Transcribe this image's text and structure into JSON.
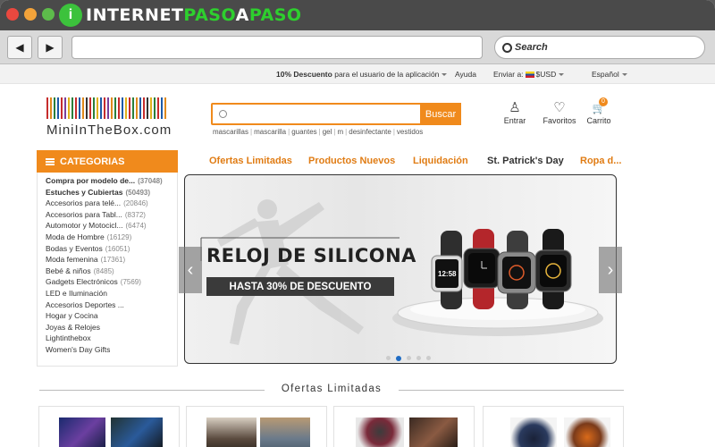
{
  "browser": {
    "brand": {
      "part1": "INTERNET",
      "part2": "PASO",
      "part3": "A",
      "part4": "PASO",
      "logo_glyph": "i"
    },
    "back_icon": "◀",
    "forward_icon": "▶",
    "url": "",
    "search_label": "Search",
    "traffic_lights": [
      "#e9483f",
      "#f3a33a",
      "#5dbb4b"
    ]
  },
  "topbar": {
    "promo_bold": "10% Descuento",
    "promo_rest": "para el usuario de la aplicación",
    "help": "Ayuda",
    "ship_to": "Enviar a:",
    "currency": "$USD",
    "language": "Español"
  },
  "header": {
    "logo_text": "MiniInTheBox.com",
    "search_placeholder": "",
    "search_button": "Buscar",
    "hot_words": [
      "mascarillas",
      "mascarilla",
      "guantes",
      "gel",
      "m",
      "desinfectante",
      "vestidos"
    ],
    "login_label": "Entrar",
    "favorites_label": "Favoritos",
    "cart_label": "Carrito",
    "cart_count": "0",
    "user_icon": "♙",
    "heart_icon": "♡",
    "cart_icon": "🛒"
  },
  "categories": {
    "title": "CATEGORIAS",
    "items": [
      {
        "label": "Compra por modelo de...",
        "count": "(37048)"
      },
      {
        "label": "Estuches y Cubiertas",
        "count": "(50493)"
      },
      {
        "label": "Accesorios para telé...",
        "count": "(20846)"
      },
      {
        "label": "Accesorios para Tabl...",
        "count": "(8372)"
      },
      {
        "label": "Automotor y Motocicl...",
        "count": "(6474)"
      },
      {
        "label": "Moda de Hombre",
        "count": "(16129)"
      },
      {
        "label": "Bodas y Eventos",
        "count": "(16051)"
      },
      {
        "label": "Moda femenina",
        "count": "(17361)"
      },
      {
        "label": "Bebé & niños",
        "count": "(8485)"
      },
      {
        "label": "Gadgets Electrónicos",
        "count": "(7569)"
      },
      {
        "label": "LED e Iluminación",
        "count": ""
      },
      {
        "label": "Accesorios Deportes ...",
        "count": ""
      },
      {
        "label": "Hogar y Cocina",
        "count": ""
      },
      {
        "label": "Joyas & Relojes",
        "count": ""
      },
      {
        "label": "Lightinthebox",
        "count": ""
      },
      {
        "label": "Women's Day Gifts",
        "count": ""
      }
    ]
  },
  "promo_nav": [
    "Ofertas Limitadas",
    "Productos Nuevos",
    "Liquidación",
    "St. Patrick's Day",
    "Ropa d..."
  ],
  "banner": {
    "title": "RELOJ DE SILICONA",
    "subtitle": "HASTA 30% DE DESCUENTO",
    "watch_time_1": "12:58",
    "slide_count": 5,
    "active_slide": 1,
    "prev_icon": "‹",
    "next_icon": "›"
  },
  "offers": {
    "title": "Ofertas Limitadas"
  }
}
